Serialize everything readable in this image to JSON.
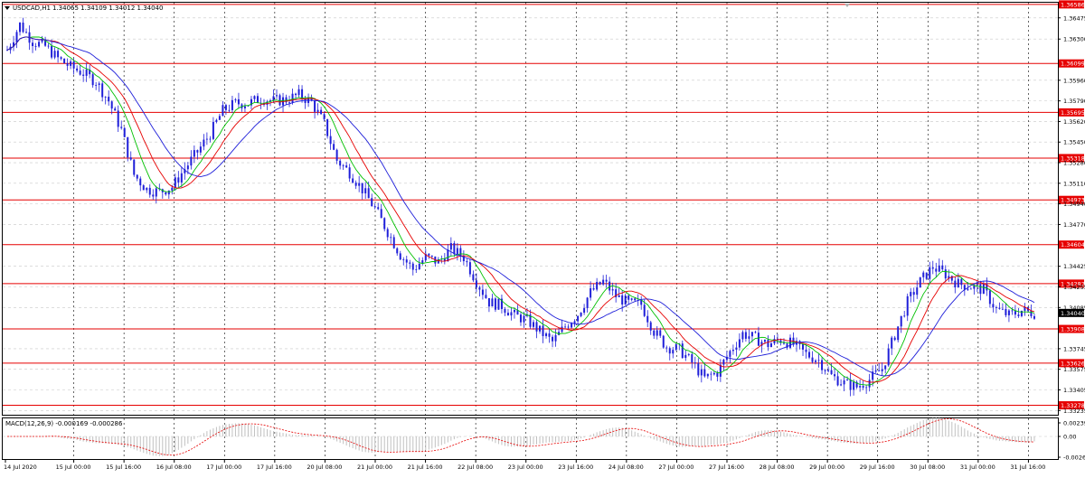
{
  "header": {
    "menu_icon": "triangle-down-icon",
    "symbol": "USDCAD,H1",
    "ohlc": "1.34065 1.34109 1.34012 1.34040"
  },
  "macd_panel": {
    "label": "MACD(12,26,9) -0.000169 -0.000286",
    "scale_labels": [
      "0.002397",
      "0.00",
      "-0.002636"
    ]
  },
  "colors": {
    "candles": "#1f1fd9",
    "ma_fast": "#00c000",
    "ma_mid": "#e60000",
    "ma_slow": "#1f1fd9",
    "levels": "#e60000",
    "price_tag": "#e60000",
    "current_price_tag": "#000000",
    "macd_signal": "#e60000",
    "macd_hist": "#c0c0c0"
  },
  "chart_data": {
    "type": "candlestick",
    "symbol": "USDCAD",
    "timeframe": "H1",
    "price_labels": [
      "1.36475",
      "1.36300",
      "1.35960",
      "1.35790",
      "1.35620",
      "1.35450",
      "1.35280",
      "1.35110",
      "1.34940",
      "1.34770",
      "1.34425",
      "1.34255",
      "1.34085",
      "1.33745",
      "1.33575",
      "1.33405",
      "1.33235"
    ],
    "time_labels": [
      "14 Jul 2020",
      "15 Jul 00:00",
      "15 Jul 16:00",
      "16 Jul 08:00",
      "17 Jul 00:00",
      "17 Jul 16:00",
      "20 Jul 08:00",
      "21 Jul 00:00",
      "21 Jul 16:00",
      "22 Jul 08:00",
      "23 Jul 00:00",
      "23 Jul 16:00",
      "24 Jul 08:00",
      "27 Jul 00:00",
      "27 Jul 16:00",
      "28 Jul 08:00",
      "29 Jul 00:00",
      "29 Jul 16:00",
      "30 Jul 08:00",
      "31 Jul 00:00",
      "31 Jul 16:00"
    ],
    "horizontal_levels": [
      "1.36586",
      "1.36099",
      "1.35695",
      "1.35318",
      "1.34973",
      "1.34604",
      "1.34282",
      "1.33908",
      "1.33626",
      "1.33278"
    ],
    "current_price": "1.34040",
    "ylim": [
      1.332,
      1.366
    ],
    "price_path": [
      [
        0,
        1.3621
      ],
      [
        4,
        1.3642
      ],
      [
        8,
        1.3628
      ],
      [
        12,
        1.3624
      ],
      [
        16,
        1.3614
      ],
      [
        20,
        1.3607
      ],
      [
        24,
        1.3602
      ],
      [
        28,
        1.3595
      ],
      [
        32,
        1.3579
      ],
      [
        36,
        1.3555
      ],
      [
        40,
        1.3518
      ],
      [
        44,
        1.3506
      ],
      [
        48,
        1.3504
      ],
      [
        52,
        1.3508
      ],
      [
        56,
        1.3523
      ],
      [
        60,
        1.3537
      ],
      [
        64,
        1.3552
      ],
      [
        68,
        1.3571
      ],
      [
        72,
        1.3577
      ],
      [
        76,
        1.3577
      ],
      [
        80,
        1.3581
      ],
      [
        84,
        1.3579
      ],
      [
        88,
        1.358
      ],
      [
        92,
        1.3584
      ],
      [
        96,
        1.3578
      ],
      [
        100,
        1.356
      ],
      [
        104,
        1.353
      ],
      [
        108,
        1.352
      ],
      [
        112,
        1.3506
      ],
      [
        116,
        1.349
      ],
      [
        120,
        1.3471
      ],
      [
        124,
        1.3452
      ],
      [
        128,
        1.344
      ],
      [
        132,
        1.345
      ],
      [
        136,
        1.3446
      ],
      [
        140,
        1.3457
      ],
      [
        144,
        1.345
      ],
      [
        148,
        1.343
      ],
      [
        152,
        1.3413
      ],
      [
        156,
        1.341
      ],
      [
        160,
        1.3402
      ],
      [
        164,
        1.3398
      ],
      [
        168,
        1.3389
      ],
      [
        172,
        1.338
      ],
      [
        176,
        1.3393
      ],
      [
        180,
        1.3403
      ],
      [
        184,
        1.3421
      ],
      [
        188,
        1.343
      ],
      [
        192,
        1.3418
      ],
      [
        196,
        1.3412
      ],
      [
        200,
        1.3411
      ],
      [
        204,
        1.3389
      ],
      [
        208,
        1.3376
      ],
      [
        212,
        1.3374
      ],
      [
        216,
        1.3363
      ],
      [
        220,
        1.335
      ],
      [
        224,
        1.3355
      ],
      [
        228,
        1.3372
      ],
      [
        232,
        1.3387
      ],
      [
        236,
        1.3383
      ],
      [
        240,
        1.3378
      ],
      [
        244,
        1.3382
      ],
      [
        248,
        1.3378
      ],
      [
        252,
        1.337
      ],
      [
        256,
        1.3365
      ],
      [
        260,
        1.3352
      ],
      [
        264,
        1.3346
      ],
      [
        268,
        1.3343
      ],
      [
        272,
        1.3349
      ],
      [
        276,
        1.3358
      ],
      [
        280,
        1.3386
      ],
      [
        284,
        1.3413
      ],
      [
        288,
        1.343
      ],
      [
        292,
        1.3442
      ],
      [
        296,
        1.3436
      ],
      [
        300,
        1.3428
      ],
      [
        304,
        1.3426
      ],
      [
        308,
        1.3423
      ],
      [
        312,
        1.3407
      ],
      [
        316,
        1.3402
      ],
      [
        320,
        1.3406
      ],
      [
        324,
        1.3404
      ]
    ],
    "indicators": [
      "ma_fast",
      "ma_mid",
      "ma_slow",
      "MACD(12,26,9)"
    ]
  }
}
